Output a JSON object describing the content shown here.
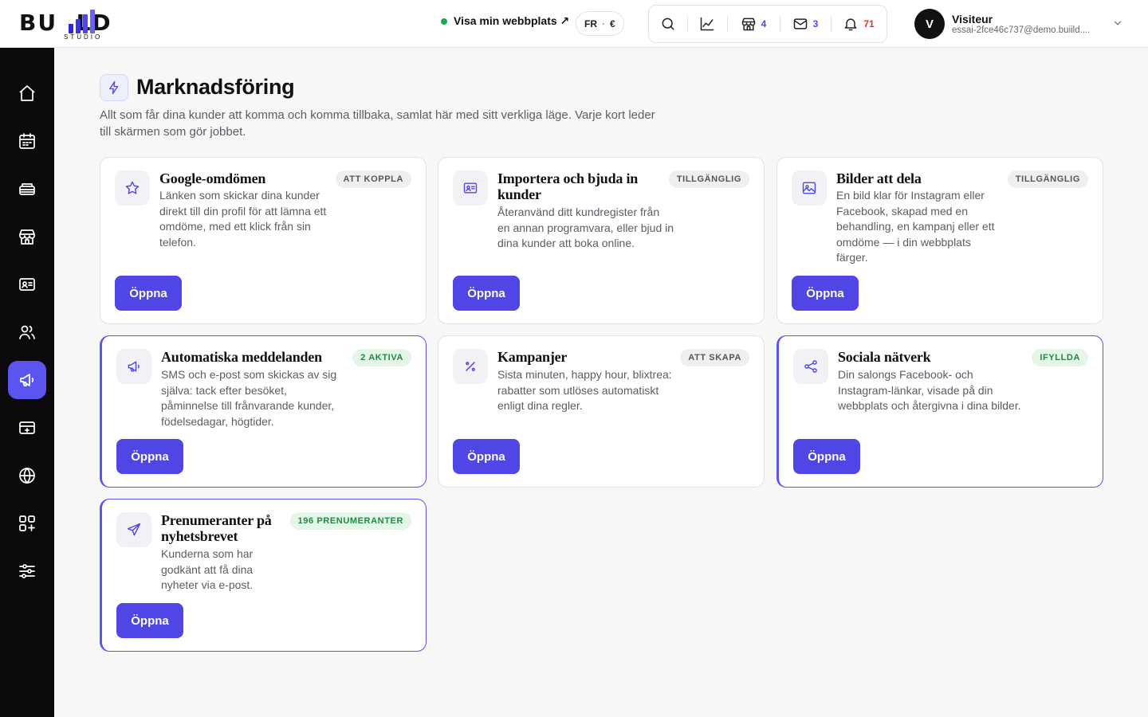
{
  "brand": {
    "logo_text": "BU  LD",
    "logo_sub": "STUDIO"
  },
  "header": {
    "visit_site": "Visa min webbplats ↗",
    "lang": "FR",
    "currency": "€",
    "shop_count": "4",
    "mail_count": "3",
    "notif_count": "71",
    "user_initial": "V",
    "user_name": "Visiteur",
    "user_email": "essai-2fce46c737@demo.buiild...."
  },
  "colors": {
    "accent": "#4f46e5",
    "active_nav": "#5b54f0",
    "online": "#1fa84f",
    "notif": "#e0342b",
    "badge_green_bg": "#e3f6e8",
    "badge_green_text": "#1e8a42"
  },
  "sidebar": {
    "items": [
      {
        "icon": "home-icon"
      },
      {
        "icon": "calendar-icon"
      },
      {
        "icon": "services-icon"
      },
      {
        "icon": "store-icon"
      },
      {
        "icon": "contact-card-icon"
      },
      {
        "icon": "users-icon"
      },
      {
        "icon": "megaphone-icon",
        "active": true
      },
      {
        "icon": "payment-icon"
      },
      {
        "icon": "globe-icon"
      },
      {
        "icon": "apps-icon"
      },
      {
        "icon": "sliders-icon"
      }
    ]
  },
  "page": {
    "title": "Marknadsföring",
    "description": "Allt som får dina kunder att komma och komma tillbaka, samlat här med sitt verkliga läge. Varje kort leder till skärmen som gör jobbet."
  },
  "cards": [
    {
      "title": "Google-omdömen",
      "badge": "ATT KOPPLA",
      "desc": "Länken som skickar dina kunder direkt till din profil för att lämna ett omdöme, med ett klick från sin telefon.",
      "button": "Öppna",
      "icon": "star-icon"
    },
    {
      "title": "Importera och bjuda in kunder",
      "badge": "TILLGÄNGLIG",
      "desc": "Återanvänd ditt kundregister från en annan programvara, eller bjud in dina kunder att boka online.",
      "button": "Öppna",
      "icon": "id-card-icon"
    },
    {
      "title": "Bilder att dela",
      "badge": "TILLGÄNGLIG",
      "desc": "En bild klar för Instagram eller Facebook, skapad med en behandling, en kampanj eller ett omdöme — i din webbplats färger.",
      "button": "Öppna",
      "icon": "image-icon"
    },
    {
      "title": "Automatiska meddelanden",
      "badge": "2 AKTIVA",
      "desc": "SMS och e-post som skickas av sig själva: tack efter besöket, påminnelse till frånvarande kunder, födelsedagar, högtider.",
      "button": "Öppna",
      "icon": "megaphone-icon"
    },
    {
      "title": "Kampanjer",
      "badge": "ATT SKAPA",
      "desc": "Sista minuten, happy hour, blixtrea: rabatter som utlöses automatiskt enligt dina regler.",
      "button": "Öppna",
      "icon": "percent-icon"
    },
    {
      "title": "Sociala nätverk",
      "badge": "IFYLLDA",
      "desc": "Din salongs Facebook- och Instagram-länkar, visade på din webbplats och återgivna i dina bilder.",
      "button": "Öppna",
      "icon": "share-icon"
    },
    {
      "title": "Prenumeranter på nyhetsbrevet",
      "badge": "196 PRENUMERANTER",
      "desc": "Kunderna som har godkänt att få dina nyheter via e-post.",
      "button": "Öppna",
      "icon": "send-icon"
    }
  ]
}
